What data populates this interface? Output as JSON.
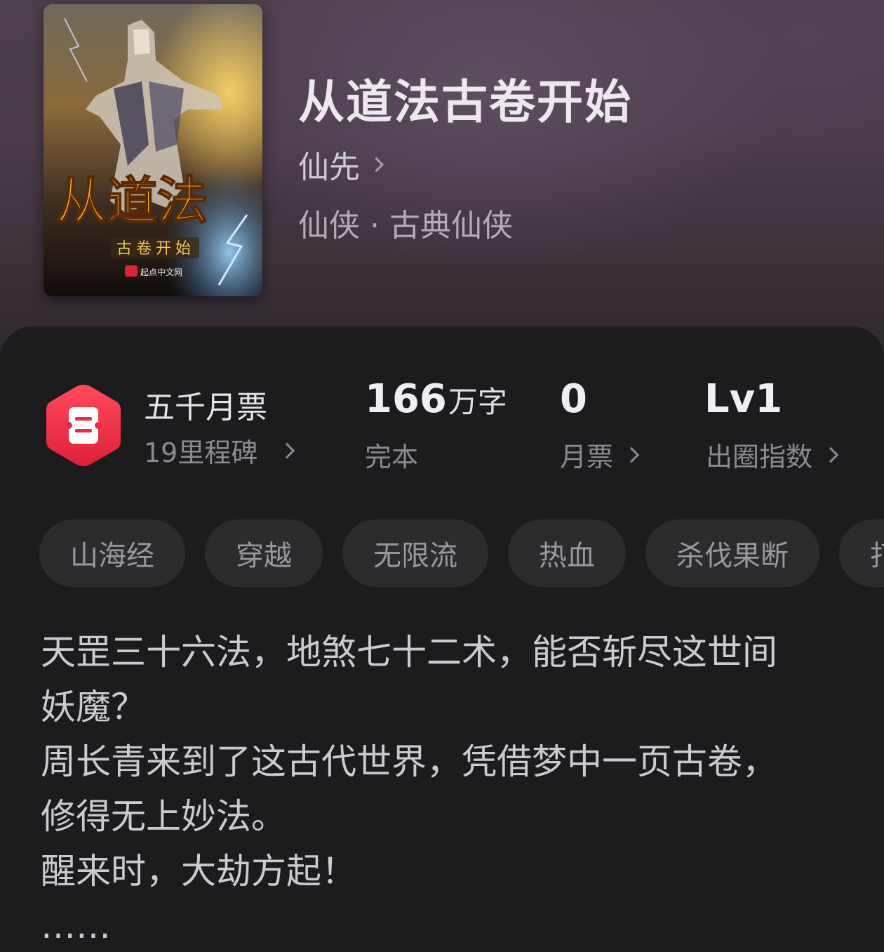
{
  "book": {
    "title": "从道法古卷开始",
    "author": "仙先",
    "category": "仙侠 · 古典仙侠",
    "cover": {
      "title_text": "从道法",
      "subtitle_text": "古卷开始",
      "publisher": "起点中文网"
    }
  },
  "stats": {
    "monthly_ticket_badge": {
      "title": "五千月票",
      "subtitle": "19里程碑",
      "icon": "ticket-icon",
      "color": "#f0304a"
    },
    "word_count": {
      "value": "166",
      "unit": "万字",
      "label": "完本"
    },
    "monthly_tickets": {
      "value": "0",
      "label": "月票"
    },
    "popularity": {
      "value": "Lv1",
      "label": "出圈指数"
    }
  },
  "tags": [
    "山海经",
    "穿越",
    "无限流",
    "热血",
    "杀伐果断",
    "打"
  ],
  "description": [
    "天罡三十六法，地煞七十二术，能否斩尽这世间",
    "妖魔？",
    "周长青来到了这古代世界，凭借梦中一页古卷，",
    "修得无上妙法。",
    "醒来时，大劫方起！",
    "……"
  ]
}
